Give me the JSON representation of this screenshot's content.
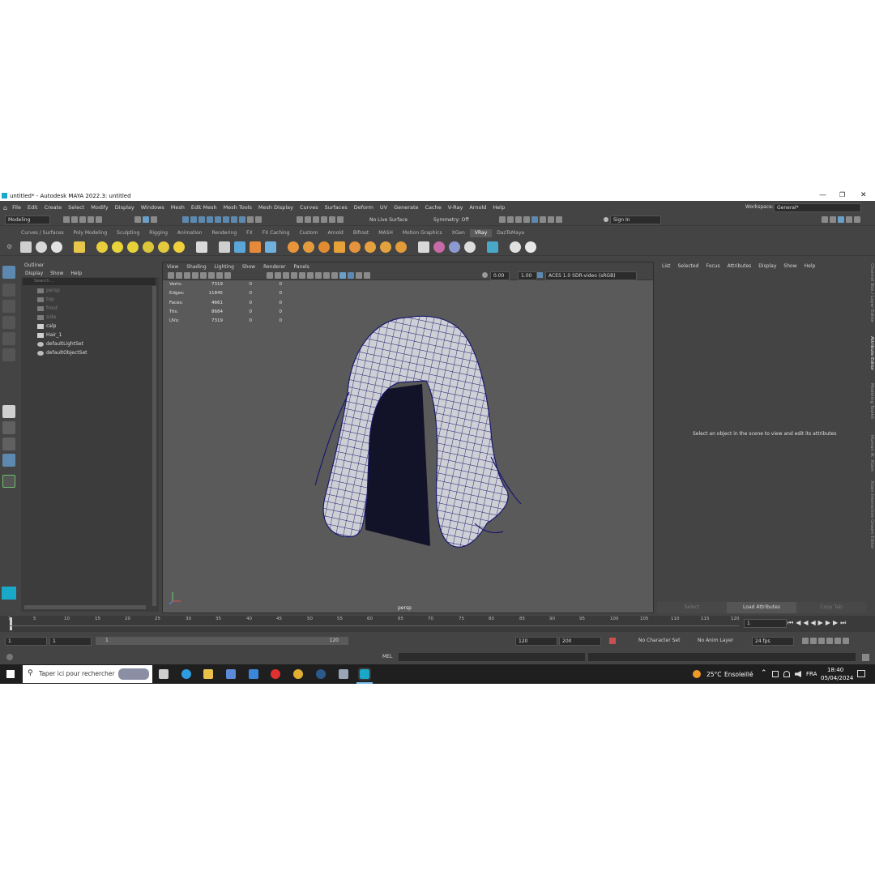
{
  "window": {
    "title": "untitled* - Autodesk MAYA 2022.3: untitled"
  },
  "menubar": {
    "items": [
      "File",
      "Edit",
      "Create",
      "Select",
      "Modify",
      "Display",
      "Windows",
      "Mesh",
      "Edit Mesh",
      "Mesh Tools",
      "Mesh Display",
      "Curves",
      "Surfaces",
      "Deform",
      "UV",
      "Generate",
      "Cache",
      "V-Ray",
      "Arnold",
      "Help"
    ],
    "workspace_label": "Workspace:",
    "workspace_value": "General*"
  },
  "statusline": {
    "mode": "Modeling",
    "live_surface": "No Live Surface",
    "symmetry": "Symmetry: Off",
    "sign_in": "Sign In"
  },
  "shelf": {
    "tabs": [
      "Curves / Surfaces",
      "Poly Modeling",
      "Sculpting",
      "Rigging",
      "Animation",
      "Rendering",
      "FX",
      "FX Caching",
      "Custom",
      "Arnold",
      "Bifrost",
      "MASH",
      "Motion Graphics",
      "XGen",
      "VRay",
      "DazToMaya"
    ],
    "active_tab": "VRay"
  },
  "outliner": {
    "title": "Outliner",
    "menu": [
      "Display",
      "Show",
      "Help"
    ],
    "search_placeholder": "Search...",
    "items": [
      {
        "label": "persp",
        "dim": true
      },
      {
        "label": "top",
        "dim": true
      },
      {
        "label": "front",
        "dim": true
      },
      {
        "label": "side",
        "dim": true
      },
      {
        "label": "calp",
        "dim": false
      },
      {
        "label": "Hair_1",
        "dim": false
      },
      {
        "label": "defaultLightSet",
        "dim": false
      },
      {
        "label": "defaultObjectSet",
        "dim": false
      }
    ]
  },
  "viewport": {
    "menu": [
      "View",
      "Shading",
      "Lighting",
      "Show",
      "Renderer",
      "Panels"
    ],
    "exposure": "0.00",
    "gamma": "1.00",
    "color_space": "ACES 1.0 SDR-video (sRGB)",
    "camera": "persp",
    "hud": [
      {
        "label": "Verts:",
        "v1": "7319",
        "v2": "0",
        "v3": "0"
      },
      {
        "label": "Edges:",
        "v1": "11845",
        "v2": "0",
        "v3": "0"
      },
      {
        "label": "Faces:",
        "v1": "4661",
        "v2": "0",
        "v3": "0"
      },
      {
        "label": "Tris:",
        "v1": "8684",
        "v2": "0",
        "v3": "0"
      },
      {
        "label": "UVs:",
        "v1": "7319",
        "v2": "0",
        "v3": "0"
      }
    ]
  },
  "attribute_editor": {
    "menu": [
      "List",
      "Selected",
      "Focus",
      "Attributes",
      "Display",
      "Show",
      "Help"
    ],
    "message": "Select an object in the scene to view and edit its attributes",
    "buttons": [
      "Select",
      "Load Attributes",
      "Copy Tab"
    ],
    "side_tabs": [
      "Channel Box / Layer Editor",
      "Attribute Editor",
      "Modeling Toolkit",
      "Human IK",
      "XGen",
      "XGen Interactive Groom Editor"
    ]
  },
  "timeline": {
    "ticks": [
      "5",
      "10",
      "15",
      "20",
      "25",
      "30",
      "35",
      "40",
      "45",
      "50",
      "55",
      "60",
      "65",
      "70",
      "75",
      "80",
      "85",
      "90",
      "95",
      "100",
      "105",
      "110",
      "115",
      "120"
    ],
    "tick_start": "1",
    "current_frame": "1"
  },
  "range": {
    "start": "1",
    "playback_start": "1",
    "slider_start": "1",
    "slider_end": "120",
    "playback_end": "120",
    "end": "200",
    "character_set": "No Character Set",
    "anim_layer": "No Anim Layer",
    "fps": "24 fps"
  },
  "cmdline": {
    "lang": "MEL"
  },
  "taskbar": {
    "search_placeholder": "Taper ici pour rechercher",
    "weather_temp": "25°C",
    "weather_text": "Ensoleillé",
    "language": "FRA",
    "time": "18:40",
    "date": "05/04/2024"
  }
}
